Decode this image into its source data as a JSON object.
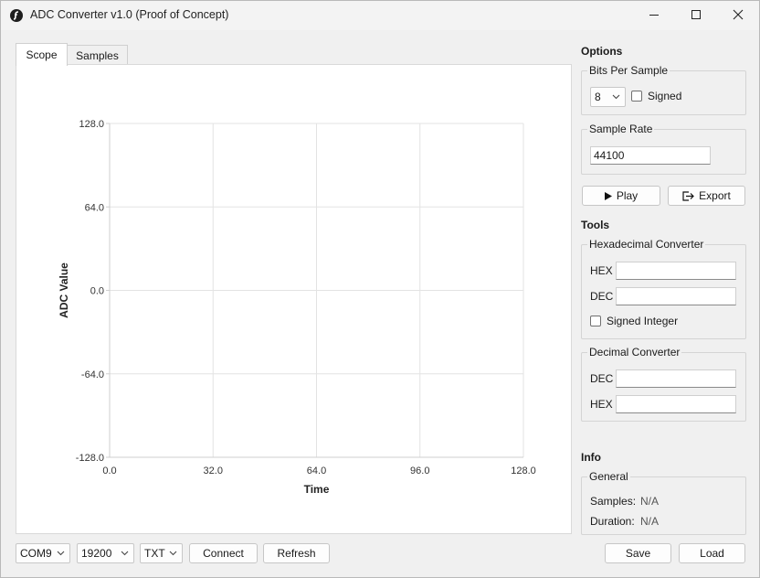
{
  "window": {
    "title": "ADC Converter v1.0 (Proof of Concept)",
    "controls": [
      "minimize-icon",
      "maximize-icon",
      "close-icon"
    ]
  },
  "tabs": [
    {
      "label": "Scope",
      "selected": true
    },
    {
      "label": "Samples",
      "selected": false
    }
  ],
  "scope_chart": {
    "chart_data": {
      "type": "line",
      "series": [],
      "xlabel": "Time",
      "ylabel": "ADC Value",
      "xlim": [
        0,
        128
      ],
      "ylim": [
        -128,
        128
      ],
      "xticks": [
        "0.0",
        "32.0",
        "64.0",
        "96.0",
        "128.0"
      ],
      "yticks": [
        "128.0",
        "64.0",
        "0.0",
        "-64.0",
        "-128.0"
      ],
      "grid": true
    }
  },
  "options": {
    "title": "Options",
    "bits_per_sample": {
      "title": "Bits Per Sample",
      "value": "8",
      "signed_label": "Signed",
      "signed_checked": false
    },
    "sample_rate": {
      "title": "Sample Rate",
      "value": "44100"
    },
    "play_label": "Play",
    "export_label": "Export"
  },
  "tools": {
    "title": "Tools",
    "hex_converter": {
      "title": "Hexadecimal Converter",
      "hex_label": "HEX",
      "hex_value": "",
      "dec_label": "DEC",
      "dec_value": "",
      "signed_label": "Signed Integer",
      "signed_checked": false
    },
    "dec_converter": {
      "title": "Decimal Converter",
      "dec_label": "DEC",
      "dec_value": "",
      "hex_label": "HEX",
      "hex_value": ""
    }
  },
  "info": {
    "title": "Info",
    "general_title": "General",
    "samples_label": "Samples:",
    "samples_value": "N/A",
    "duration_label": "Duration:",
    "duration_value": "N/A"
  },
  "bottom_bar": {
    "port": "COM9",
    "baud": "19200",
    "format": "TXT",
    "connect_label": "Connect",
    "refresh_label": "Refresh",
    "save_label": "Save",
    "load_label": "Load"
  },
  "colors": {
    "grid": "#e3e3e3",
    "axis": "#cfcfcf",
    "panel": "#ffffff",
    "background": "#f0f0f0"
  }
}
